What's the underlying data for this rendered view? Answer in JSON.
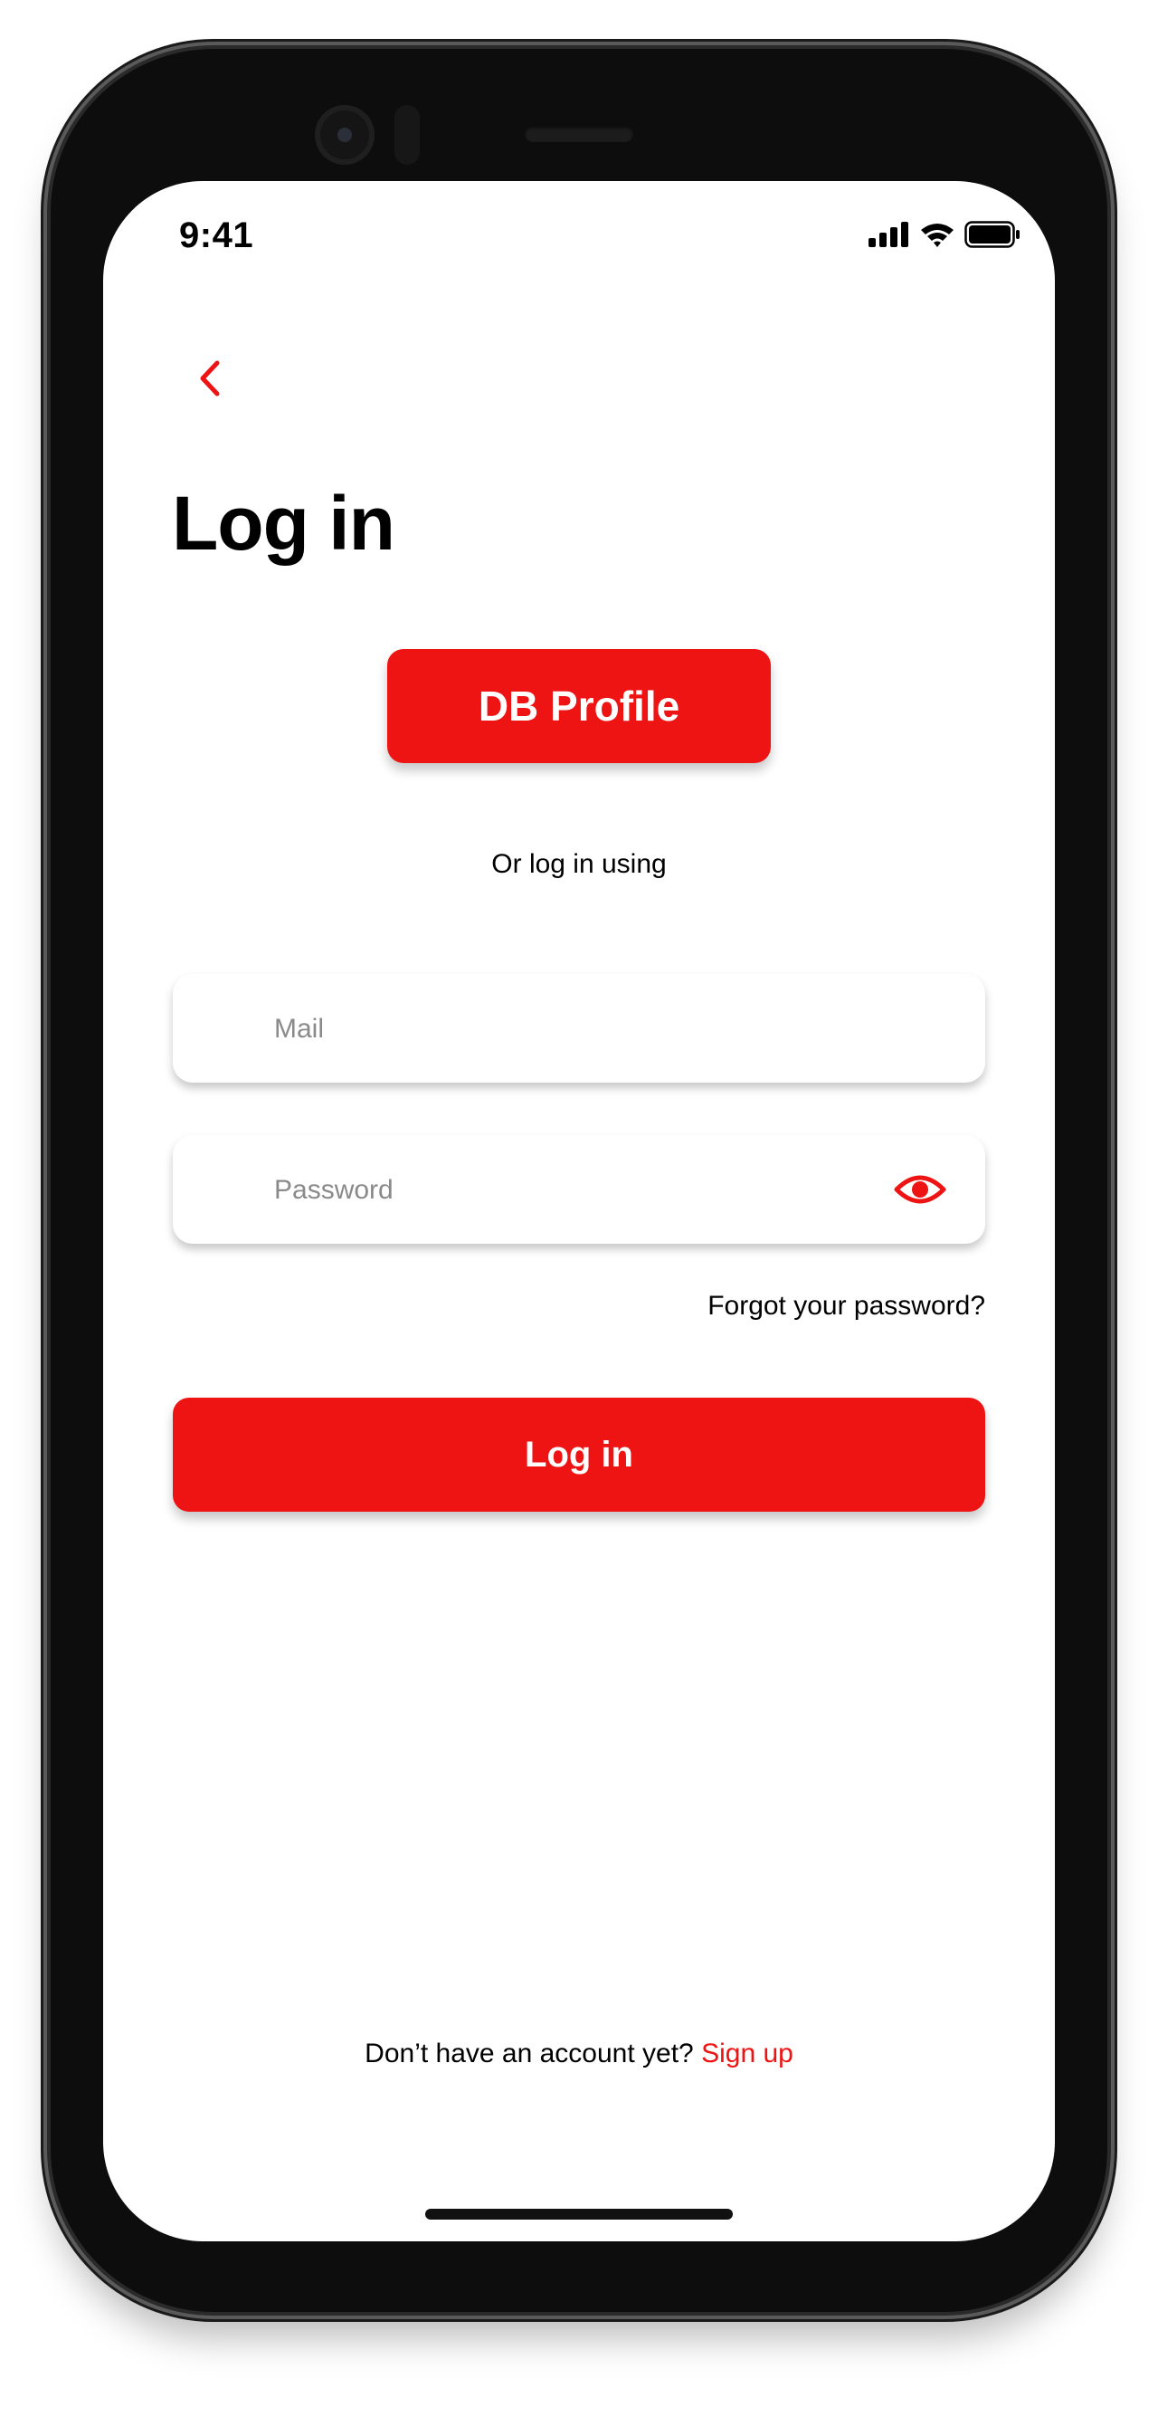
{
  "status_bar": {
    "time": "9:41",
    "icons": [
      "cellular-signal-icon",
      "wifi-icon",
      "battery-icon"
    ]
  },
  "header": {
    "back_icon": "chevron-left-icon",
    "title": "Log in"
  },
  "profile_button": {
    "label": "DB Profile"
  },
  "divider_text": "Or log in using",
  "form": {
    "mail": {
      "placeholder": "Mail",
      "value": ""
    },
    "password": {
      "placeholder": "Password",
      "value": "",
      "toggle_icon": "eye-icon"
    },
    "forgot_label": "Forgot your password?",
    "submit_label": "Log in"
  },
  "footer": {
    "prompt": "Don’t have an account yet?",
    "signup_label": "Sign up"
  },
  "colors": {
    "accent": "#ee1414",
    "text": "#000000",
    "placeholder": "#8a8a8a",
    "background": "#ffffff"
  }
}
